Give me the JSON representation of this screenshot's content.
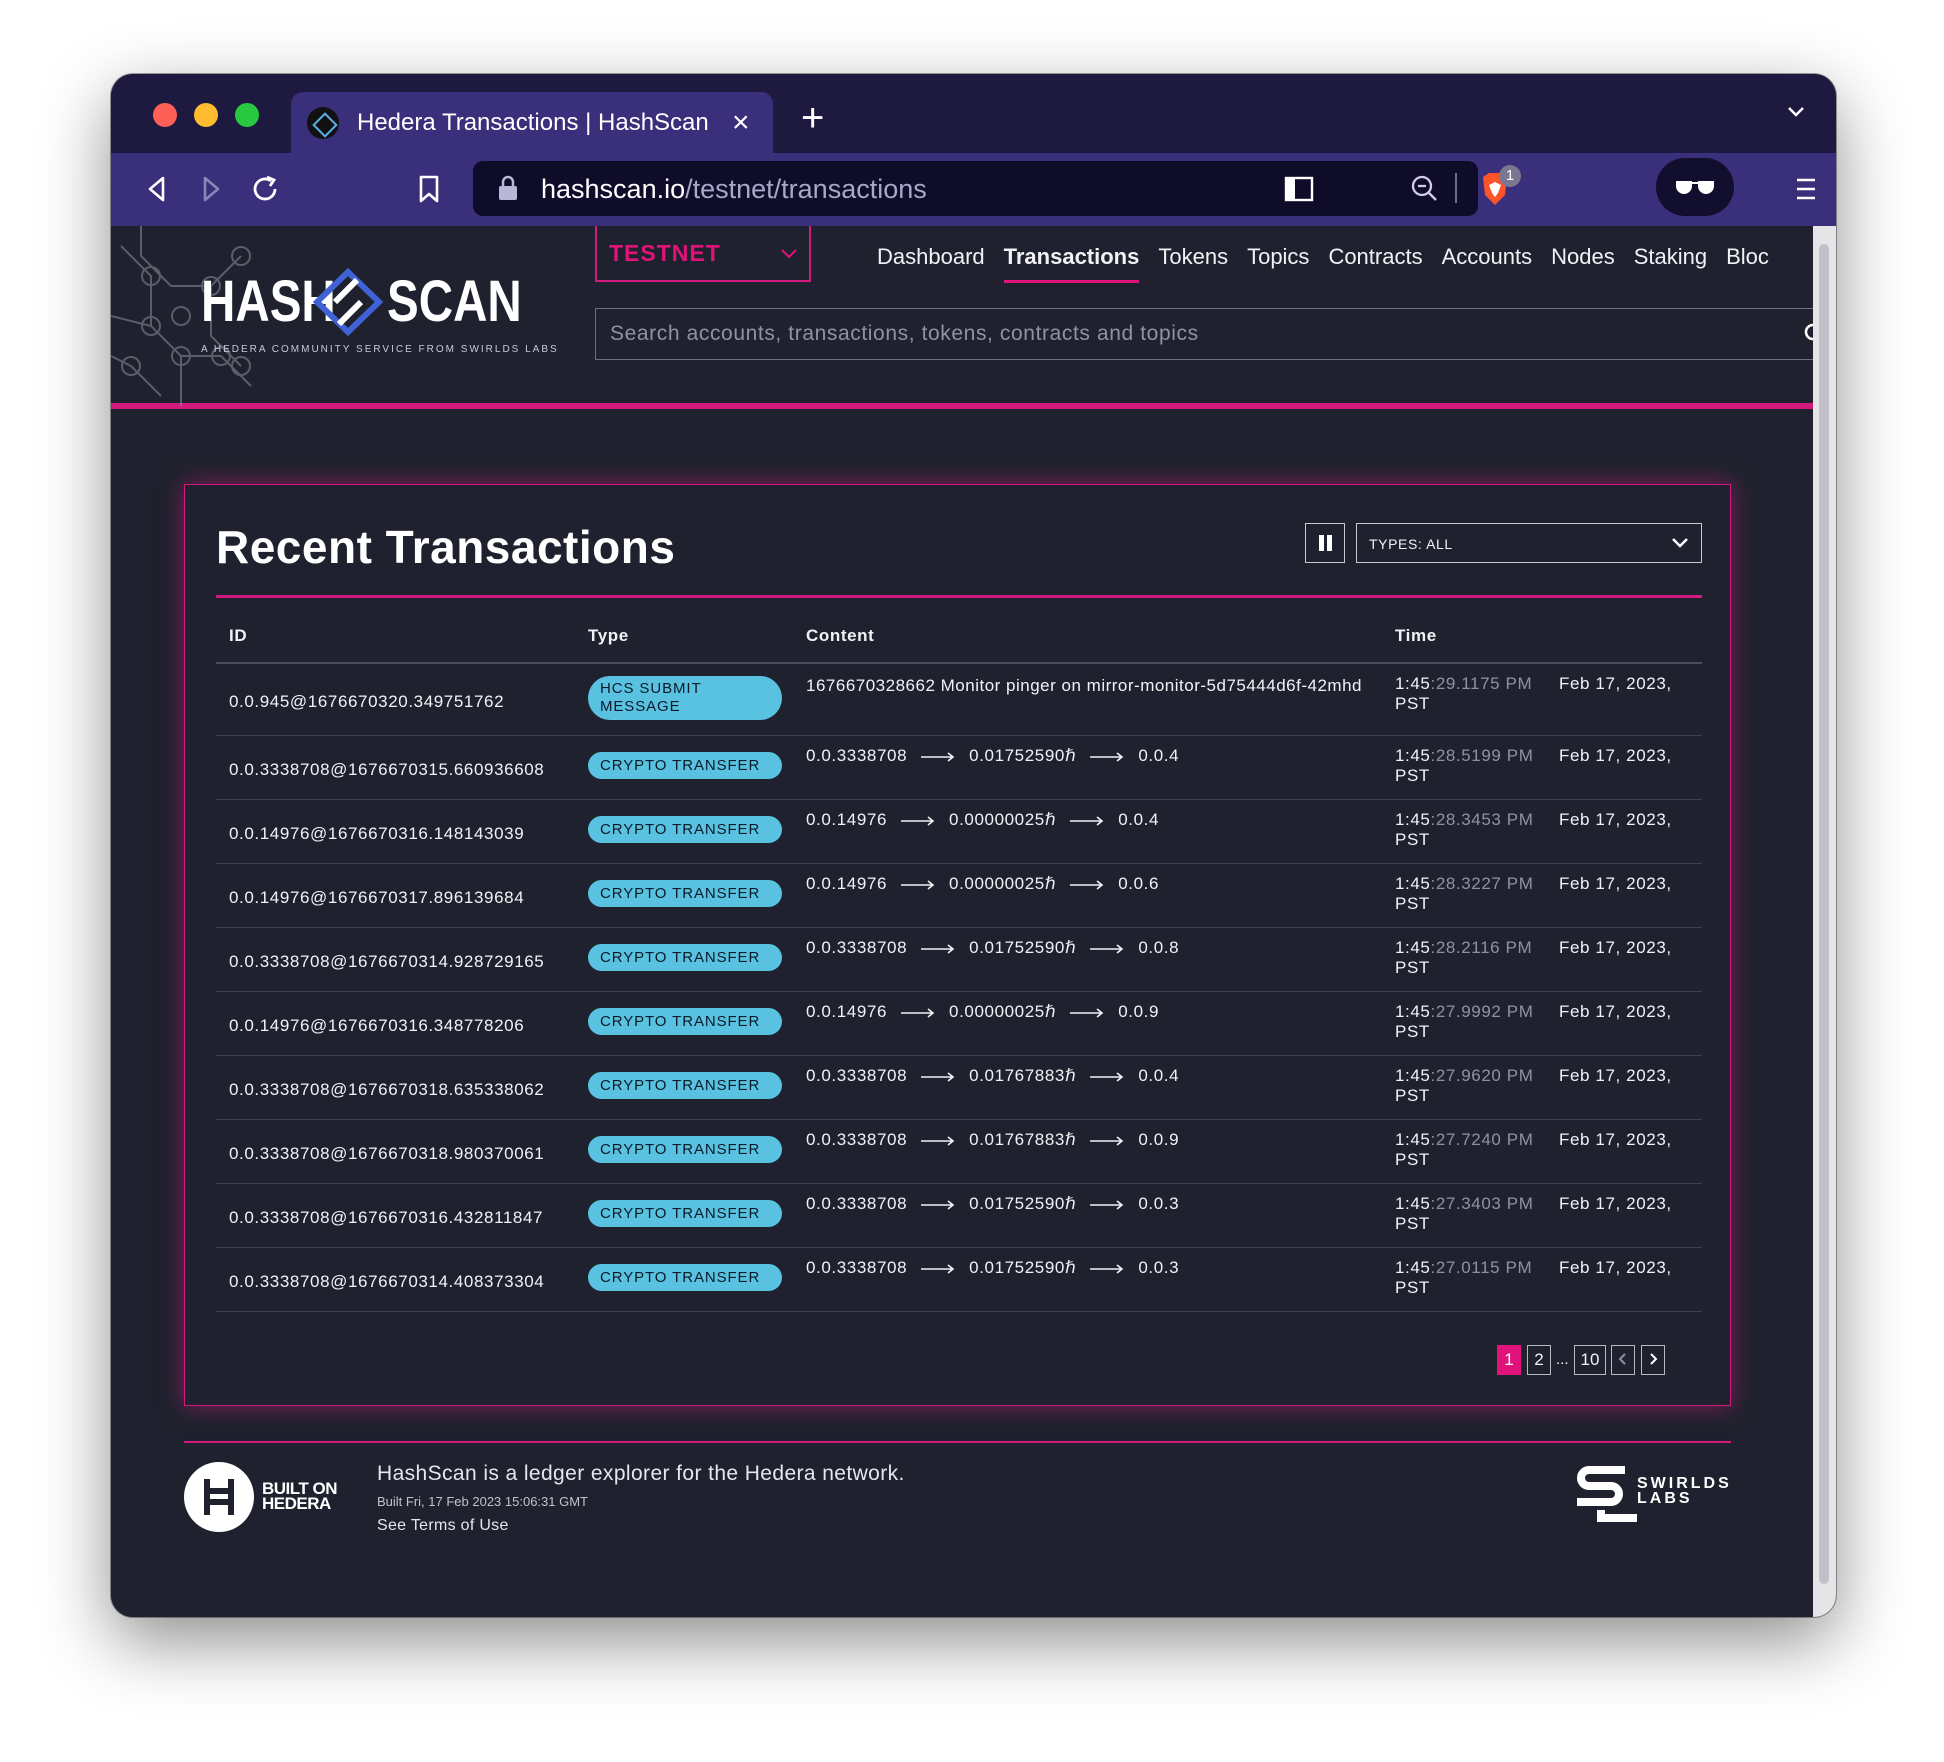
{
  "browser": {
    "tab_title": "Hedera Transactions | HashScan",
    "url_host": "hashscan.io",
    "url_path": "/testnet/transactions",
    "shields_count": "1"
  },
  "header": {
    "logo_left": "HASH",
    "logo_right": "SCAN",
    "tagline": "A HEDERA COMMUNITY SERVICE FROM SWIRLDS LABS",
    "network": "TESTNET",
    "nav": [
      {
        "label": "Dashboard",
        "active": false
      },
      {
        "label": "Transactions",
        "active": true
      },
      {
        "label": "Tokens",
        "active": false
      },
      {
        "label": "Topics",
        "active": false
      },
      {
        "label": "Contracts",
        "active": false
      },
      {
        "label": "Accounts",
        "active": false
      },
      {
        "label": "Nodes",
        "active": false
      },
      {
        "label": "Staking",
        "active": false
      },
      {
        "label": "Bloc",
        "active": false
      }
    ],
    "search_placeholder": "Search accounts, transactions, tokens, contracts and topics"
  },
  "card": {
    "title": "Recent Transactions",
    "types_filter": "TYPES: ALL",
    "columns": [
      "ID",
      "Type",
      "Content",
      "Time"
    ],
    "rows": [
      {
        "id": "0.0.945@1676670320.349751762",
        "type": "HCS SUBMIT MESSAGE",
        "content": "1676670328662 Monitor pinger on mirror-monitor-5d75444d6f-42mhd",
        "time_hm": "1:45",
        "time_sec": ":29.1175 PM",
        "date": "Feb 17, 2023,",
        "tz": "PST"
      },
      {
        "id": "0.0.3338708@1676670315.660936608",
        "type": "CRYPTO TRANSFER",
        "from": "0.0.3338708",
        "amount": "0.01752590ℏ",
        "to": "0.0.4",
        "time_hm": "1:45",
        "time_sec": ":28.5199 PM",
        "date": "Feb 17, 2023,",
        "tz": "PST"
      },
      {
        "id": "0.0.14976@1676670316.148143039",
        "type": "CRYPTO TRANSFER",
        "from": "0.0.14976",
        "amount": "0.00000025ℏ",
        "to": "0.0.4",
        "time_hm": "1:45",
        "time_sec": ":28.3453 PM",
        "date": "Feb 17, 2023,",
        "tz": "PST"
      },
      {
        "id": "0.0.14976@1676670317.896139684",
        "type": "CRYPTO TRANSFER",
        "from": "0.0.14976",
        "amount": "0.00000025ℏ",
        "to": "0.0.6",
        "time_hm": "1:45",
        "time_sec": ":28.3227 PM",
        "date": "Feb 17, 2023,",
        "tz": "PST"
      },
      {
        "id": "0.0.3338708@1676670314.928729165",
        "type": "CRYPTO TRANSFER",
        "from": "0.0.3338708",
        "amount": "0.01752590ℏ",
        "to": "0.0.8",
        "time_hm": "1:45",
        "time_sec": ":28.2116 PM",
        "date": "Feb 17, 2023,",
        "tz": "PST"
      },
      {
        "id": "0.0.14976@1676670316.348778206",
        "type": "CRYPTO TRANSFER",
        "from": "0.0.14976",
        "amount": "0.00000025ℏ",
        "to": "0.0.9",
        "time_hm": "1:45",
        "time_sec": ":27.9992 PM",
        "date": "Feb 17, 2023,",
        "tz": "PST"
      },
      {
        "id": "0.0.3338708@1676670318.635338062",
        "type": "CRYPTO TRANSFER",
        "from": "0.0.3338708",
        "amount": "0.01767883ℏ",
        "to": "0.0.4",
        "time_hm": "1:45",
        "time_sec": ":27.9620 PM",
        "date": "Feb 17, 2023,",
        "tz": "PST"
      },
      {
        "id": "0.0.3338708@1676670318.980370061",
        "type": "CRYPTO TRANSFER",
        "from": "0.0.3338708",
        "amount": "0.01767883ℏ",
        "to": "0.0.9",
        "time_hm": "1:45",
        "time_sec": ":27.7240 PM",
        "date": "Feb 17, 2023,",
        "tz": "PST"
      },
      {
        "id": "0.0.3338708@1676670316.432811847",
        "type": "CRYPTO TRANSFER",
        "from": "0.0.3338708",
        "amount": "0.01752590ℏ",
        "to": "0.0.3",
        "time_hm": "1:45",
        "time_sec": ":27.3403 PM",
        "date": "Feb 17, 2023,",
        "tz": "PST"
      },
      {
        "id": "0.0.3338708@1676670314.408373304",
        "type": "CRYPTO TRANSFER",
        "from": "0.0.3338708",
        "amount": "0.01752590ℏ",
        "to": "0.0.3",
        "time_hm": "1:45",
        "time_sec": ":27.0115 PM",
        "date": "Feb 17, 2023,",
        "tz": "PST"
      }
    ],
    "pagination": {
      "pages": [
        "1",
        "2",
        "10"
      ],
      "ellipsis": "...",
      "current": "1"
    }
  },
  "footer": {
    "built_on_line1": "BUILT ON",
    "built_on_line2": "HEDERA",
    "description": "HashScan is a ledger explorer for the Hedera network.",
    "build": "Built Fri, 17 Feb 2023 15:06:31 GMT",
    "terms": "See Terms of Use",
    "swirlds_line1": "SWIRLDS",
    "swirlds_line2": "LABS"
  },
  "colors": {
    "accent": "#d4197e",
    "badge": "#58c2e0",
    "background": "#1f222e",
    "browser_chrome": "#3a2f7a"
  }
}
